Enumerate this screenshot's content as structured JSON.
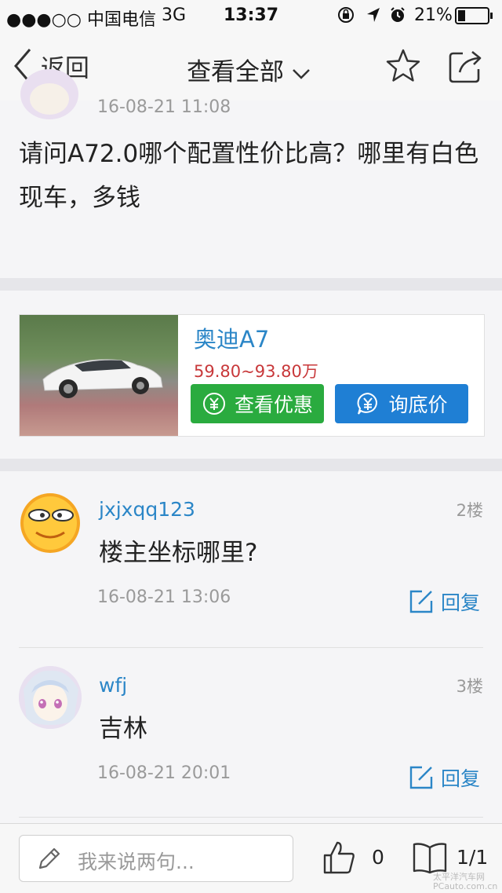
{
  "status_bar": {
    "carrier": "●●●○○ 中国电信",
    "network": "3G",
    "time": "13:37",
    "battery": "21%"
  },
  "nav": {
    "back_label": "返回",
    "title": "查看全部"
  },
  "post": {
    "time": "16-08-21 11:08",
    "content": "请问A72.0哪个配置性价比高？哪里有白色现车，多钱"
  },
  "ad": {
    "car_name": "奥迪A7",
    "price": "59.80~93.80万",
    "btn_deal": "查看优惠",
    "btn_price": "询底价",
    "colors": {
      "green": "#2aab3f",
      "blue": "#1f7fd4"
    }
  },
  "replies": [
    {
      "user": "jxjxqq123",
      "floor": "2楼",
      "text": "楼主坐标哪里?",
      "time": "16-08-21 13:06",
      "reply_label": "回复"
    },
    {
      "user": "wfj",
      "floor": "3楼",
      "text": "吉林",
      "time": "16-08-21 20:01",
      "reply_label": "回复"
    }
  ],
  "bottom": {
    "input_placeholder": "我来说两句...",
    "likes": "0",
    "pages": "1/1"
  },
  "watermark": "太平洋汽车网 PCauto.com.cn"
}
